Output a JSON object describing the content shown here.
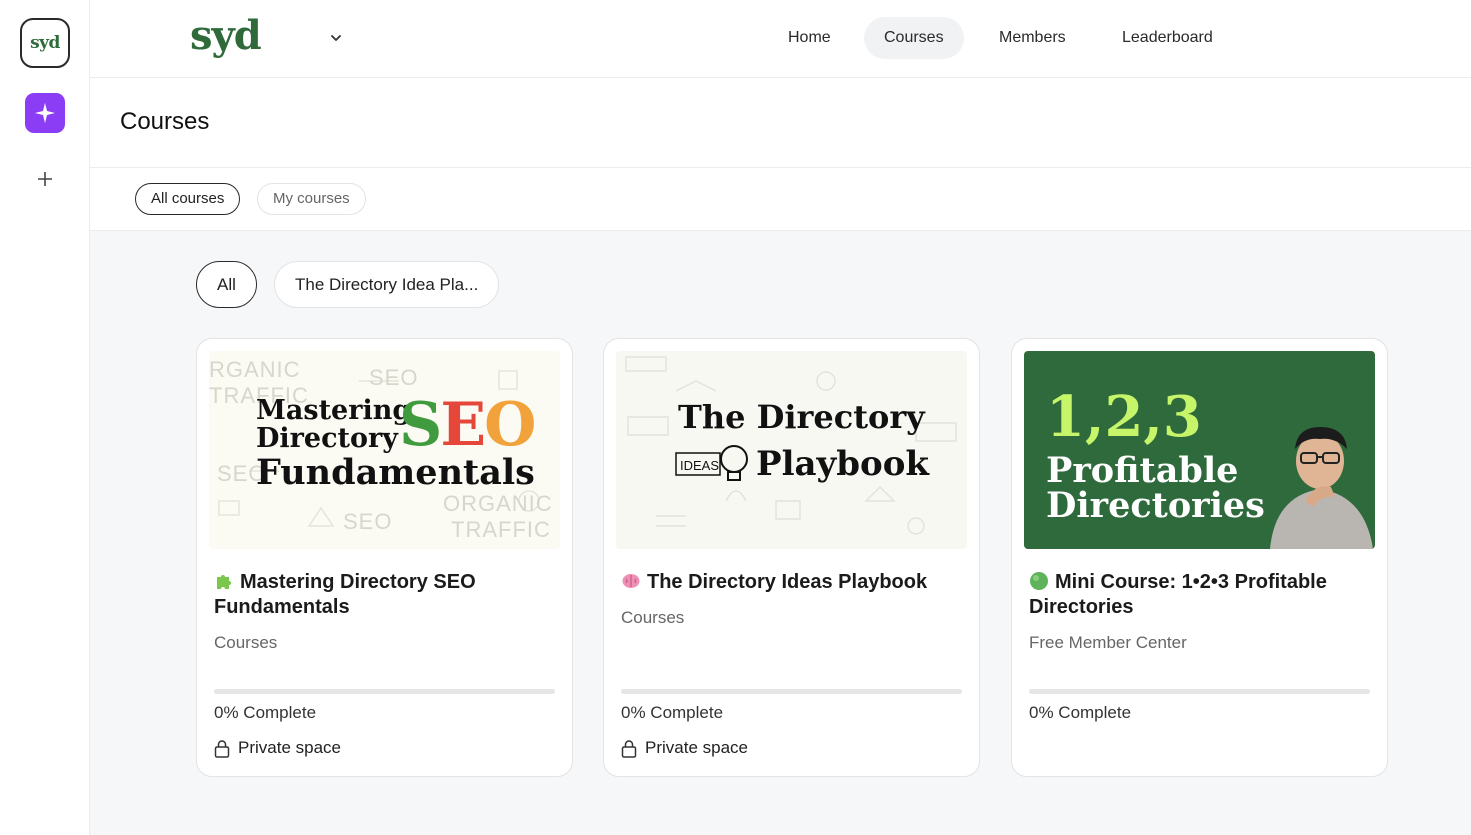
{
  "app": {
    "rail_logo": "syd",
    "brand": "syd"
  },
  "nav": [
    {
      "label": "Home",
      "active": false
    },
    {
      "label": "Courses",
      "active": true
    },
    {
      "label": "Members",
      "active": false
    },
    {
      "label": "Leaderboard",
      "active": false
    }
  ],
  "page": {
    "title": "Courses"
  },
  "tabs": [
    {
      "label": "All courses",
      "active": true
    },
    {
      "label": "My courses",
      "active": false
    }
  ],
  "chips": [
    {
      "label": "All",
      "active": true
    },
    {
      "label": "The Directory Idea Pla...",
      "active": false
    }
  ],
  "courses": [
    {
      "title": "Mastering Directory SEO Fundamentals",
      "category": "Courses",
      "progress": 0,
      "progress_label": "0% Complete",
      "privacy": "Private space",
      "thumb": {
        "line1": "Mastering",
        "line2": "Directory",
        "big_s": "S",
        "big_e": "E",
        "big_o": "O",
        "line3": "Fundamentals"
      }
    },
    {
      "title": "The Directory Ideas Playbook",
      "category": "Courses",
      "progress": 0,
      "progress_label": "0% Complete",
      "privacy": "Private space",
      "thumb": {
        "line1": "The Directory",
        "line2": "Playbook"
      }
    },
    {
      "title": "Mini Course: 1•2•3 Profitable Directories",
      "category": "Free Member Center",
      "progress": 0,
      "progress_label": "0% Complete",
      "thumb": {
        "line1": "1,2,3",
        "line2": "Profitable",
        "line3": "Directories"
      }
    }
  ],
  "colors": {
    "brand_green": "#2f6b3a",
    "ai_purple": "#8b3df5",
    "mini_bg": "#2e6a3c",
    "mini_accent": "#c7f56a"
  }
}
